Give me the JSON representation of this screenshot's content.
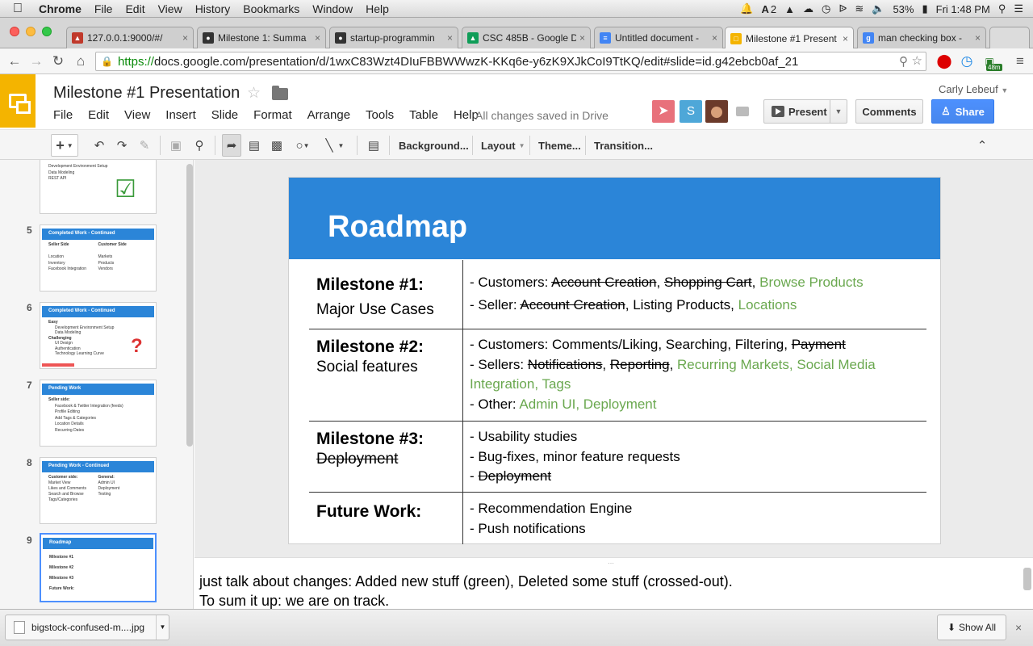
{
  "macos": {
    "apple": "",
    "menus": [
      "Chrome",
      "File",
      "Edit",
      "View",
      "History",
      "Bookmarks",
      "Window",
      "Help"
    ],
    "status": {
      "notif_count": "2",
      "battery": "53%",
      "clock": "Fri 1:48 PM"
    }
  },
  "tabs": [
    {
      "title": "127.0.0.1:9000/#/",
      "favicon": "hat",
      "color": "#c0392b"
    },
    {
      "title": "Milestone 1: Summa",
      "favicon": "github",
      "color": "#333333"
    },
    {
      "title": "startup-programmin",
      "favicon": "github",
      "color": "#333333"
    },
    {
      "title": "CSC 485B - Google D",
      "favicon": "drive",
      "color": "#0f9d58"
    },
    {
      "title": "Untitled document -",
      "favicon": "docs",
      "color": "#4285f4"
    },
    {
      "title": "Milestone #1 Present",
      "favicon": "slides",
      "color": "#f4b400"
    },
    {
      "title": "man checking box -",
      "favicon": "google",
      "color": "#4285f4"
    }
  ],
  "address": {
    "scheme": "https://",
    "rest": "docs.google.com/presentation/d/1wxC83Wzt4DIuFBBWWwzK-KKq6e-y6zK9XJkCoI9TtKQ/edit#slide=id.g42ebcb0af_21"
  },
  "extension_badge": "48m",
  "doc": {
    "title": "Milestone #1 Presentation",
    "menu": [
      "File",
      "Edit",
      "View",
      "Insert",
      "Slide",
      "Format",
      "Arrange",
      "Tools",
      "Table",
      "Help"
    ],
    "save_status": "All changes saved in Drive",
    "user": "Carly Lebeuf",
    "avatar_s": "S",
    "present_label": "Present",
    "comments_label": "Comments",
    "share_label": "Share"
  },
  "toolbar": {
    "background": "Background...",
    "layout": "Layout",
    "theme": "Theme...",
    "transition": "Transition..."
  },
  "filmstrip": [
    {
      "num": "",
      "title": "",
      "lines": [
        "Development Environment Setup",
        "Data Modeling",
        "REST API"
      ]
    },
    {
      "num": "5",
      "title": "Completed Work - Continued",
      "col1_head": "Seller Side",
      "col1": [
        "Location",
        "Inventory",
        "Facebook Integration"
      ],
      "col2_head": "Customer Side",
      "col2": [
        "Markets",
        "Products",
        "Vendors"
      ]
    },
    {
      "num": "6",
      "title": "Completed Work - Continued",
      "lines": [
        "Easy",
        "Development Environment Setup",
        "Data Modeling",
        "Challenging",
        "UI Design",
        "Authentication",
        "Technology Learning Curve"
      ]
    },
    {
      "num": "7",
      "title": "Pending Work",
      "lines": [
        "Seller side:",
        "Facebook & Twitter Integration (feeds)",
        "Profile Editing",
        "Add Tags & Categories",
        "Location Details",
        "Recurring Dates"
      ]
    },
    {
      "num": "8",
      "title": "Pending Work - Continued",
      "col1_head": "Customer side:",
      "col1": [
        "Market View",
        "Likes and Comments",
        "Search and Browse Tags/Categories"
      ],
      "col2_head": "General:",
      "col2": [
        "Admin UI",
        "Deployment",
        "Testing"
      ]
    },
    {
      "num": "9",
      "title": "Roadmap",
      "lines": [
        "Milestone #1",
        "Milestone #2",
        "Milestone #3",
        "Future Work:"
      ]
    }
  ],
  "slide": {
    "title": "Roadmap",
    "rows": [
      {
        "head": "Milestone #1:",
        "sub": "Major Use Cases"
      },
      {
        "head": "Milestone #2:",
        "sub": "Social features"
      },
      {
        "head": "Milestone #3:",
        "sub": "Deployment"
      },
      {
        "head": "Future Work:",
        "sub": ""
      }
    ],
    "r1": {
      "l1_a": "- Customers: ",
      "l1_b": "Account Creation",
      ",": ",",
      "l1_c": "Shopping Cart",
      "l1_d": ", ",
      "l1_e": "Browse Products",
      "l2_a": "- Seller: ",
      "l2_b": "Account Creation",
      "l2_c": ", Listing Products, ",
      "l2_d": "Locations"
    },
    "r2": {
      "l1_a": "- Customers: Comments/Liking, Searching, Filtering, ",
      "l1_b": "Payment",
      "l2_a": "- Sellers: ",
      "l2_b": "Notifications",
      ",": ", ",
      "l2_c": "Reporting",
      "l2_d": ", ",
      "l2_e": "Recurring Markets, Social Media",
      "l3": "Integration, Tags",
      "l4_a": "- Other: ",
      "l4_b": "Admin UI, Deployment"
    },
    "r3": {
      "l1": "- Usability studies",
      "l2": "- Bug-fixes, minor feature requests",
      "l3_a": "- ",
      "l3_b": "Deployment"
    },
    "r4": {
      "l1": "- Recommendation Engine",
      "l2": "- Push notifications"
    }
  },
  "notes": {
    "line1": "just talk about changes: Added new stuff (green), Deleted some stuff (crossed-out).",
    "line2": "To sum it up: we are on track."
  },
  "downloads": {
    "file": "bigstock-confused-m....jpg",
    "show_all": "Show All"
  },
  "colors": {
    "slides_yellow": "#f4b400",
    "slide_blue": "#2b85d8",
    "added_green": "#6aa84f",
    "share_blue": "#4d90fe"
  }
}
